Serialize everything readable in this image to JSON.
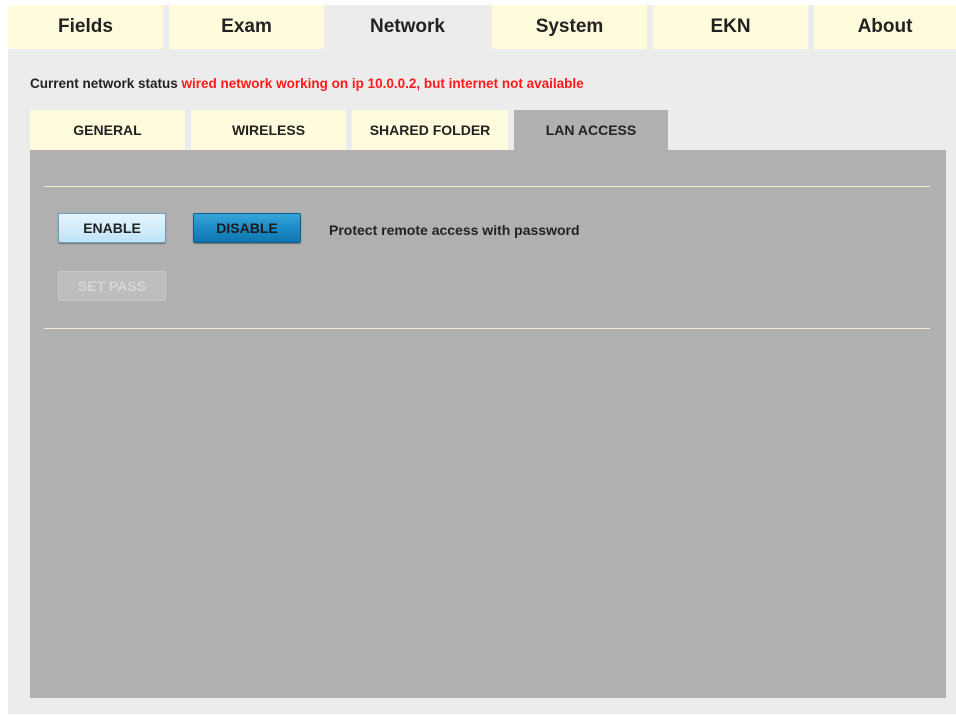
{
  "top_tabs": [
    {
      "label": "Fields",
      "active": false
    },
    {
      "label": "Exam",
      "active": false
    },
    {
      "label": "Network",
      "active": true
    },
    {
      "label": "System",
      "active": false
    },
    {
      "label": "EKN",
      "active": false
    },
    {
      "label": "About",
      "active": false
    }
  ],
  "status": {
    "label": "Current network status",
    "value": "wired network working on ip 10.0.0.2, but internet not available"
  },
  "sub_tabs": [
    {
      "label": "GENERAL",
      "active": false
    },
    {
      "label": "WIRELESS",
      "active": false
    },
    {
      "label": "SHARED FOLDER",
      "active": false
    },
    {
      "label": "LAN ACCESS",
      "active": true
    }
  ],
  "lan_access": {
    "enable_label": "ENABLE",
    "disable_label": "DISABLE",
    "protect_label": "Protect remote access with password",
    "set_pass_label": "SET PASS"
  },
  "colors": {
    "tab_bg": "#fffbdc",
    "active_tab_bg": "#ececec",
    "panel_bg": "#b0b0b0",
    "status_value": "#ff1a1a",
    "disable_button": "#1d8cc6"
  }
}
